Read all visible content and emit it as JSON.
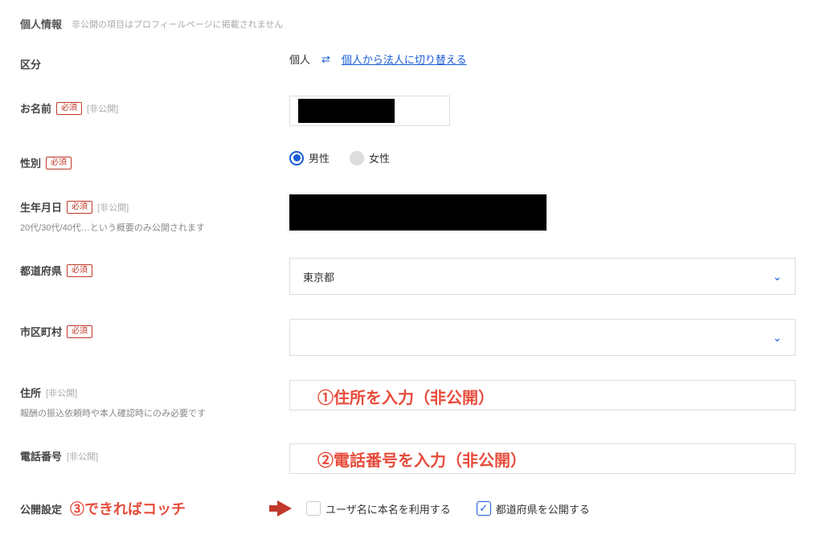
{
  "header": {
    "title": "個人情報",
    "note": "非公開の項目はプロフィールページに掲載されません"
  },
  "type": {
    "label": "区分",
    "value": "個人",
    "switch": "個人から法人に切り替える"
  },
  "name": {
    "label": "お名前",
    "required": "必須",
    "private": "[非公開]"
  },
  "gender": {
    "label": "性別",
    "required": "必須",
    "options": {
      "male": "男性",
      "female": "女性"
    }
  },
  "birth": {
    "label": "生年月日",
    "required": "必須",
    "private": "[非公開]",
    "hint": "20代/30代/40代…という概要のみ公開されます"
  },
  "pref": {
    "label": "都道府県",
    "required": "必須",
    "value": "東京都"
  },
  "city": {
    "label": "市区町村",
    "required": "必須",
    "value": ""
  },
  "address": {
    "label": "住所",
    "private": "[非公開]",
    "hint": "報酬の振込依頼時や本人確認時にのみ必要です",
    "overlay": "①住所を入力（非公開）"
  },
  "phone": {
    "label": "電話番号",
    "private": "[非公開]",
    "overlay": "②電話番号を入力（非公開）"
  },
  "public": {
    "label": "公開設定",
    "annotation": "③できればコッチ",
    "useRealName": "ユーザ名に本名を利用する",
    "showPref": "都道府県を公開する"
  }
}
